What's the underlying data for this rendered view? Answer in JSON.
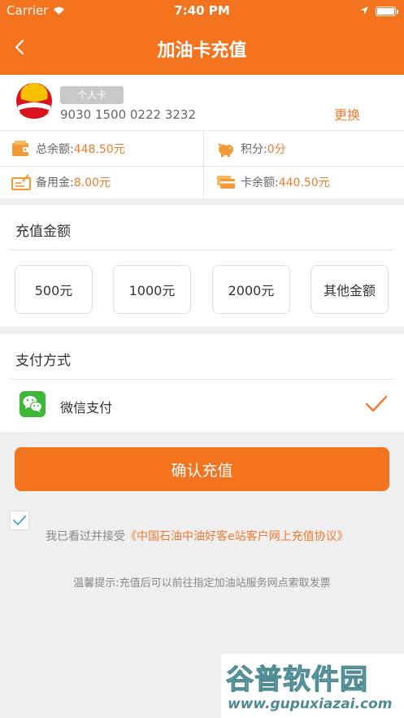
{
  "status_bar": {
    "carrier": "Carrier",
    "time": "7:40 PM"
  },
  "header": {
    "title": "加油卡充值"
  },
  "card": {
    "type_badge": "个人卡",
    "number": "9030 1500 0222 3232",
    "change_label": "更换",
    "total_label": "总余额:",
    "total_value": "448.50元",
    "points_label": "积分:",
    "points_value": "0分",
    "reserve_label": "备用金:",
    "reserve_value": "8.00元",
    "card_balance_label": "卡余额:",
    "card_balance_value": "440.50元"
  },
  "amount_section": {
    "title": "充值金额",
    "options": [
      "500元",
      "1000元",
      "2000元",
      "其他金额"
    ]
  },
  "payment_section": {
    "title": "支付方式",
    "method": "微信支付"
  },
  "confirm_label": "确认充值",
  "agreement": {
    "prefix": "我已看过并接受",
    "link": "《中国石油中油好客e站客户网上充值协议》"
  },
  "tip": "温馨提示:充值后可以前往指定加油站服务网点索取发票",
  "watermark": {
    "main": "谷普软件园",
    "url": "www.gupuxiazai.com"
  },
  "colors": {
    "accent": "#f4731e",
    "accent_text": "#ee7b2f",
    "wechat": "#3fb838"
  }
}
